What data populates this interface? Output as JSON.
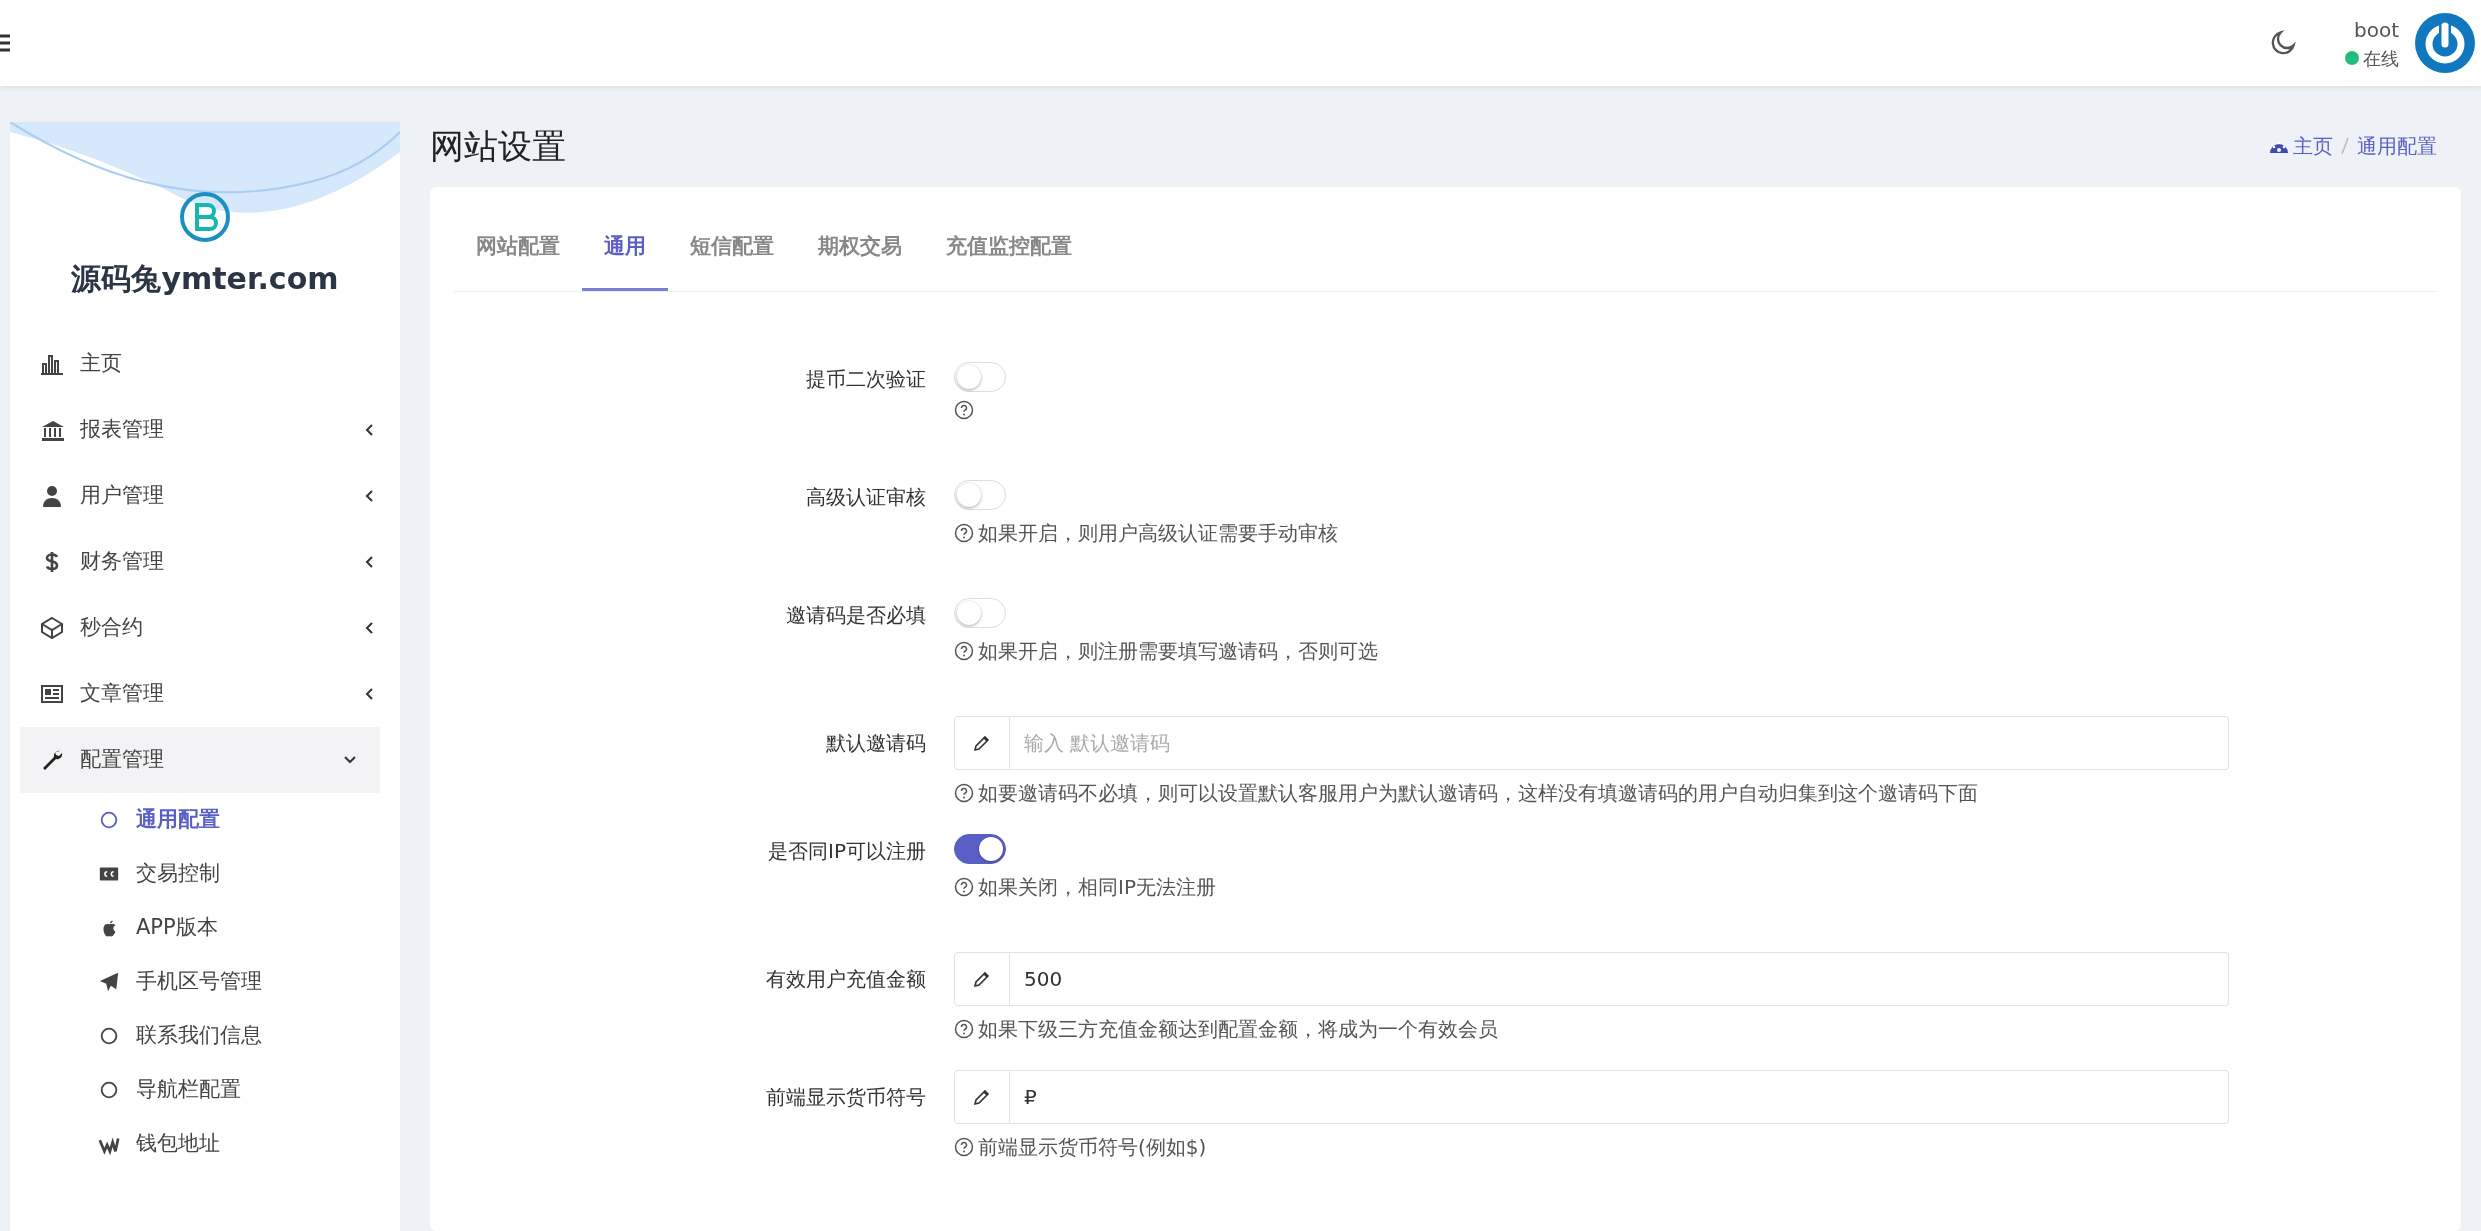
{
  "header": {
    "user": "boot",
    "status": "在线"
  },
  "sidebar": {
    "brand": "源码兔ymter.com",
    "items": [
      {
        "label": "主页"
      },
      {
        "label": "报表管理",
        "expanded": false
      },
      {
        "label": "用户管理",
        "expanded": false
      },
      {
        "label": "财务管理",
        "expanded": false
      },
      {
        "label": "秒合约",
        "expanded": false
      },
      {
        "label": "文章管理",
        "expanded": false
      },
      {
        "label": "配置管理",
        "expanded": true,
        "children": [
          {
            "label": "通用配置",
            "selected": true
          },
          {
            "label": "交易控制",
            "selected": false
          },
          {
            "label": "APP版本",
            "selected": false
          },
          {
            "label": "手机区号管理",
            "selected": false
          },
          {
            "label": "联系我们信息",
            "selected": false
          },
          {
            "label": "导航栏配置",
            "selected": false
          },
          {
            "label": "钱包地址",
            "selected": false
          }
        ]
      }
    ]
  },
  "page": {
    "title": "网站设置",
    "breadcrumb": [
      "主页",
      "通用配置"
    ]
  },
  "tabs": [
    {
      "label": "网站配置",
      "selected": false
    },
    {
      "label": "通用",
      "selected": true
    },
    {
      "label": "短信配置",
      "selected": false
    },
    {
      "label": "期权交易",
      "selected": false
    },
    {
      "label": "充值监控配置",
      "selected": false
    }
  ],
  "fields": [
    {
      "kind": "toggle",
      "label": "提币二次验证",
      "on": false
    },
    {
      "kind": "toggle",
      "label": "高级认证审核",
      "on": false,
      "help": "如果开启，则用户高级认证需要手动审核"
    },
    {
      "kind": "toggle",
      "label": "邀请码是否必填",
      "on": false,
      "help": "如果开启，则注册需要填写邀请码，否则可选"
    },
    {
      "kind": "input",
      "label": "默认邀请码",
      "placeholder": "输入 默认邀请码",
      "help": "如要邀请码不必填，则可以设置默认客服用户为默认邀请码，这样没有填邀请码的用户自动归集到这个邀请码下面"
    },
    {
      "kind": "toggle",
      "label": "是否同IP可以注册",
      "on": true,
      "help": "如果关闭，相同IP无法注册"
    },
    {
      "kind": "input",
      "label": "有效用户充值金额",
      "value": "500",
      "help": "如果下级三方充值金额达到配置金额，将成为一个有效会员"
    },
    {
      "kind": "input",
      "label": "前端显示货币符号",
      "value": "₽",
      "help": "前端显示货币符号(例如$)"
    }
  ]
}
